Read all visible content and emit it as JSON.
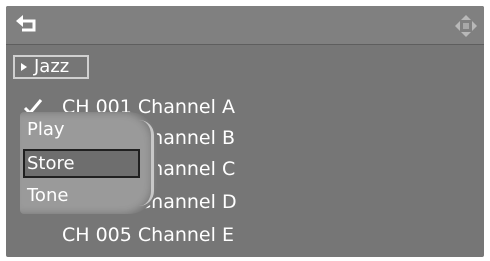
{
  "category": {
    "label": "Jazz"
  },
  "channels": [
    {
      "label": "CH 001 Channel A",
      "checked": true
    },
    {
      "label": "CH 002 Channel B"
    },
    {
      "label": "CH 003 Channel C"
    },
    {
      "label": "CH 004 Channel D"
    },
    {
      "label": "CH 005 Channel E"
    }
  ],
  "popup_menu": {
    "items": [
      "Play",
      "Store",
      "Tone"
    ],
    "selected": "Store"
  },
  "icons": {
    "back": "back-arrow-icon",
    "nav": "nav-controller-icon",
    "check": "checkmark-icon"
  }
}
